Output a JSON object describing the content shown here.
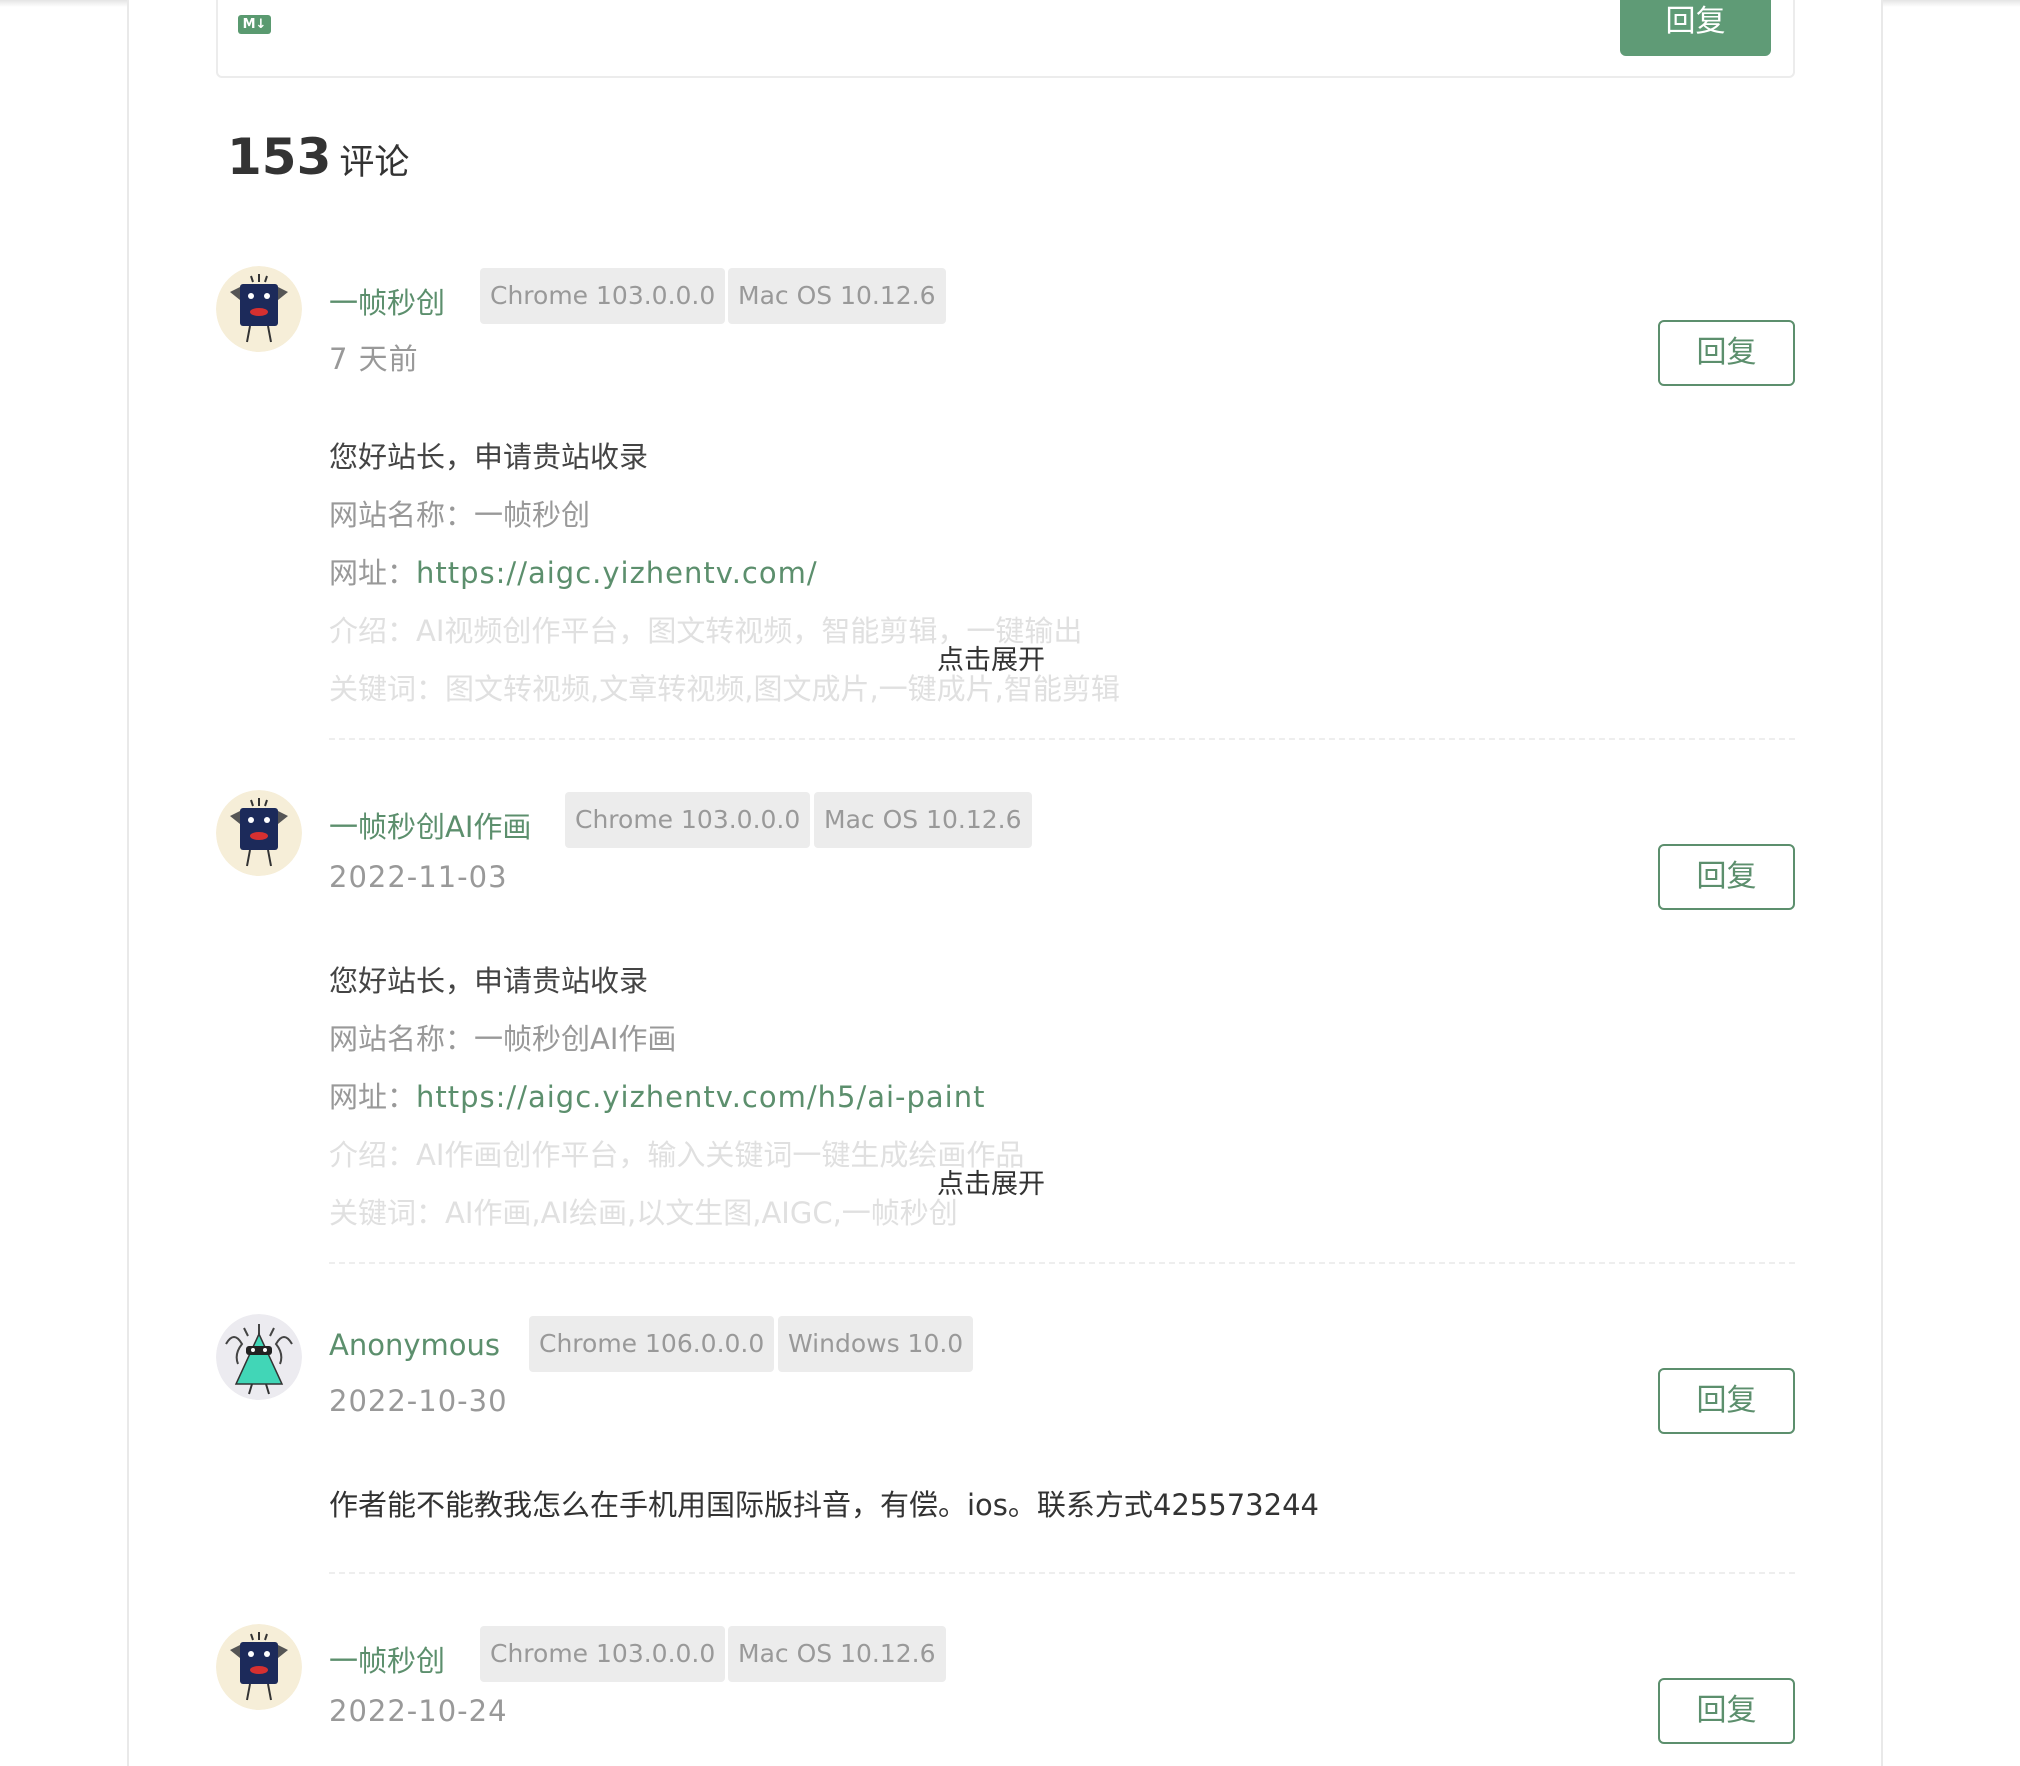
{
  "editor": {
    "md_badge": "M↓",
    "submit_label": "回复"
  },
  "comments_header": {
    "count": "153",
    "label": "评论"
  },
  "comments": [
    {
      "author": "一帧秒创",
      "browser": "Chrome 103.0.0.0",
      "os": "Mac OS 10.12.6",
      "date": "7 天前",
      "reply_label": "回复",
      "line1": "您好站长，申请贵站收录",
      "name_label": "网站名称：",
      "name_value": "一帧秒创",
      "url_label": "网址：",
      "url": "https://aigc.yizhentv.com/",
      "intro_label": "介绍：",
      "intro_value": "AI视频创作平台，图文转视频，智能剪辑，一键输出",
      "keywords_label": "关键词：",
      "keywords_value": "图文转视频,文章转视频,图文成片,一键成片,智能剪辑",
      "expand_label": "点击展开"
    },
    {
      "author": "一帧秒创AI作画",
      "browser": "Chrome 103.0.0.0",
      "os": "Mac OS 10.12.6",
      "date": "2022-11-03",
      "reply_label": "回复",
      "line1": "您好站长，申请贵站收录",
      "name_label": "网站名称：",
      "name_value": "一帧秒创AI作画",
      "url_label": "网址：",
      "url": "https://aigc.yizhentv.com/h5/ai-paint",
      "intro_label": "介绍：",
      "intro_value": "AI作画创作平台，输入关键词一键生成绘画作品",
      "keywords_label": "关键词：",
      "keywords_value": "AI作画,AI绘画,以文生图,AIGC,一帧秒创",
      "expand_label": "点击展开"
    },
    {
      "author": "Anonymous",
      "browser": "Chrome 106.0.0.0",
      "os": "Windows 10.0",
      "date": "2022-10-30",
      "reply_label": "回复",
      "text": "作者能不能教我怎么在手机用国际版抖音，有偿。ios。联系方式425573244"
    },
    {
      "author": "一帧秒创",
      "browser": "Chrome 103.0.0.0",
      "os": "Mac OS 10.12.6",
      "date": "2022-10-24",
      "reply_label": "回复"
    }
  ],
  "colors": {
    "accent": "#5c8f6d",
    "button_fill": "#5f9b76",
    "tag_bg": "#ececec"
  }
}
